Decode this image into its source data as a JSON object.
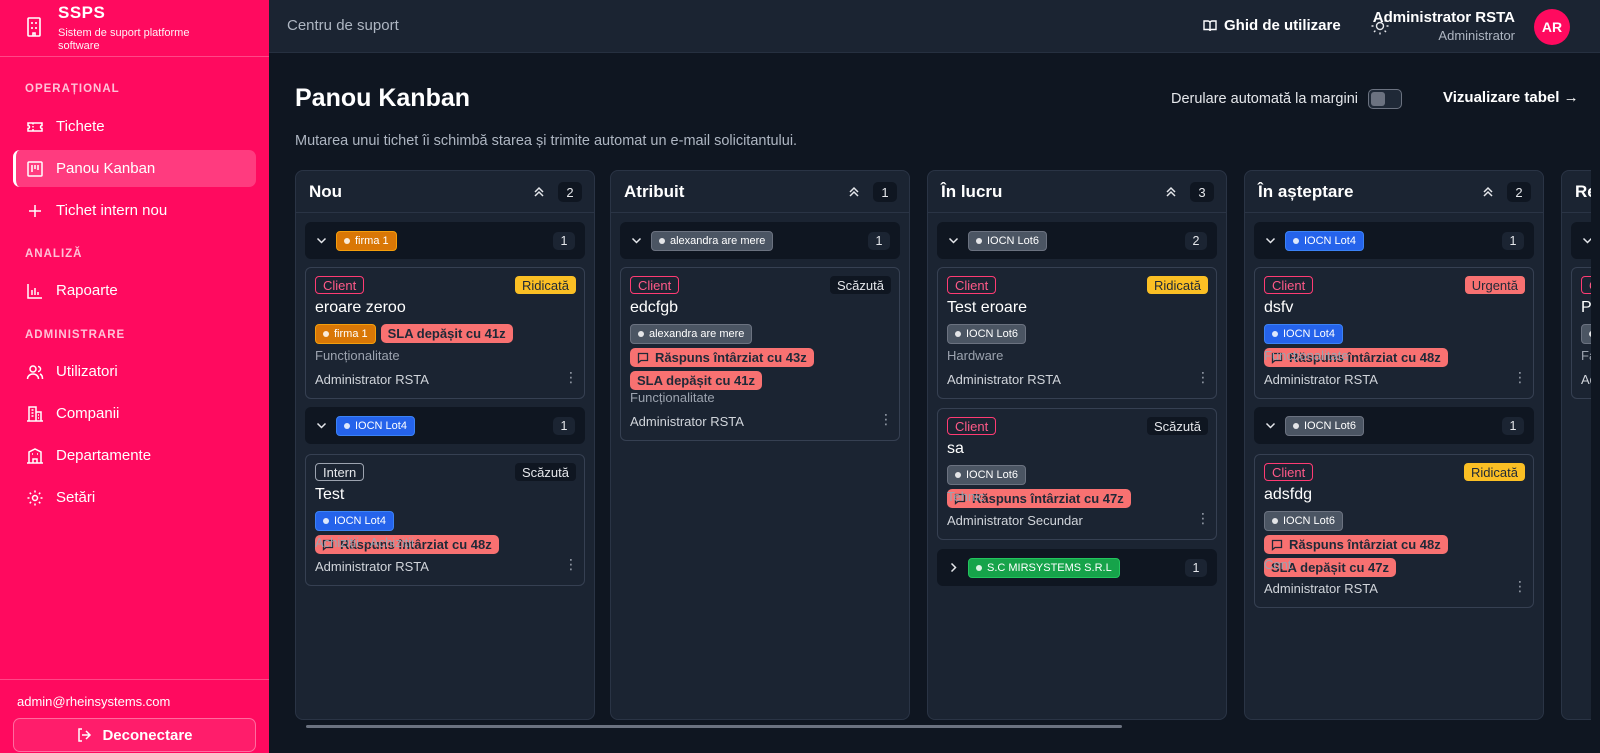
{
  "brand": {
    "title": "SSPS",
    "subtitle": "Sistem de suport platforme software"
  },
  "sidebar": {
    "sections": [
      {
        "label": "OPERAȚIONAL"
      },
      {
        "label": "ANALIZĂ"
      },
      {
        "label": "ADMINISTRARE"
      }
    ],
    "items": [
      {
        "label": "Tichete",
        "icon": "ticket-icon"
      },
      {
        "label": "Panou Kanban",
        "icon": "kanban-icon",
        "active": true
      },
      {
        "label": "Tichet intern nou",
        "icon": "plus-icon"
      },
      {
        "label": "Rapoarte",
        "icon": "bar-chart-icon"
      },
      {
        "label": "Utilizatori",
        "icon": "users-icon"
      },
      {
        "label": "Companii",
        "icon": "building-icon"
      },
      {
        "label": "Departamente",
        "icon": "department-icon"
      },
      {
        "label": "Setări",
        "icon": "gear-icon"
      }
    ],
    "email": "admin@rheinsystems.com",
    "logout": "Deconectare"
  },
  "topbar": {
    "title": "Centru de suport",
    "guide": "Ghid de utilizare",
    "user_name": "Administrator RSTA",
    "user_role": "Administrator",
    "avatar": "AR"
  },
  "main": {
    "title": "Panou Kanban",
    "subtitle": "Mutarea unui tichet îi schimbă starea și trimite automat un e-mail solicitantului.",
    "autoscroll_label": "Derulare automată la margini",
    "autoscroll_on": false,
    "table_view": "Vizualizare tabel →"
  },
  "colors": {
    "accent": "#ff0a5f",
    "background": "#0f1621",
    "panel": "#1b2432",
    "sla": "#f87171",
    "high": "#fbbf24"
  },
  "columns": [
    {
      "title": "Nou",
      "count": "2",
      "groups": [
        {
          "label": "firma 1",
          "color": "orange",
          "count": "1",
          "expanded": true,
          "cards": [
            {
              "kind": "Client",
              "priority": "Ridicată",
              "title": "eroare zeroo",
              "tag": "firma 1",
              "tag_color": "orange",
              "alerts": [
                "SLA depășit cu 41z"
              ],
              "category": "Funcționalitate",
              "assignee": "Administrator RSTA"
            }
          ]
        },
        {
          "label": "IOCN Lot4",
          "color": "blue",
          "count": "1",
          "expanded": true,
          "cards": [
            {
              "kind": "Intern",
              "priority": "Scăzută",
              "title": "Test",
              "tag": "IOCN Lot4",
              "tag_color": "blue",
              "alerts": [
                "Răspuns întârziat cu 48z"
              ],
              "category": "Achiziții · Achiziții",
              "assignee": "Administrator RSTA"
            }
          ]
        }
      ]
    },
    {
      "title": "Atribuit",
      "count": "1",
      "groups": [
        {
          "label": "alexandra are mere",
          "color": "gray",
          "count": "1",
          "expanded": true,
          "cards": [
            {
              "kind": "Client",
              "priority": "Scăzută",
              "title": "edcfgb",
              "tag": "alexandra are mere",
              "tag_color": "gray",
              "alerts": [
                "Răspuns întârziat cu 43z",
                "SLA depășit cu 41z"
              ],
              "category": "Funcționalitate",
              "assignee": "Administrator RSTA"
            }
          ]
        }
      ]
    },
    {
      "title": "În lucru",
      "count": "3",
      "groups": [
        {
          "label": "IOCN Lot6",
          "color": "gray",
          "count": "2",
          "expanded": true,
          "cards": [
            {
              "kind": "Client",
              "priority": "Ridicată",
              "title": "Test eroare",
              "tag": "IOCN Lot6",
              "tag_color": "gray",
              "alerts": [],
              "category": "Hardware",
              "assignee": "Administrator RSTA"
            },
            {
              "kind": "Client",
              "priority": "Scăzută",
              "title": "sa",
              "tag": "IOCN Lot6",
              "tag_color": "gray",
              "alerts": [
                "Răspuns întârziat cu 47z"
              ],
              "category": "Tehnic",
              "assignee": "Administrator Secundar"
            }
          ]
        },
        {
          "label": "S.C MIRSYSTEMS S.R.L",
          "color": "green",
          "count": "1",
          "expanded": false,
          "cards": []
        }
      ]
    },
    {
      "title": "În așteptare",
      "count": "2",
      "groups": [
        {
          "label": "IOCN Lot4",
          "color": "blue",
          "count": "1",
          "expanded": true,
          "cards": [
            {
              "kind": "Client",
              "priority": "Urgentă",
              "title": "dsfv",
              "tag": "IOCN Lot4",
              "tag_color": "blue",
              "alerts": [
                "Răspuns întârziat cu 48z"
              ],
              "category": "Funcționalitate",
              "assignee": "Administrator RSTA"
            }
          ]
        },
        {
          "label": "IOCN Lot6",
          "color": "gray",
          "count": "1",
          "expanded": true,
          "cards": [
            {
              "kind": "Client",
              "priority": "Ridicată",
              "title": "adsfdg",
              "tag": "IOCN Lot6",
              "tag_color": "gray",
              "alerts": [
                "Răspuns întârziat cu 48z",
                "SLA depășit cu 47z"
              ],
              "category": "Cont",
              "assignee": "Administrator RSTA"
            }
          ]
        }
      ]
    },
    {
      "title": "Rezolvat",
      "partial": {
        "title": "Re",
        "kind": "C",
        "card_title": "Pr",
        "category": "Fac",
        "assignee": "Ad"
      }
    }
  ]
}
